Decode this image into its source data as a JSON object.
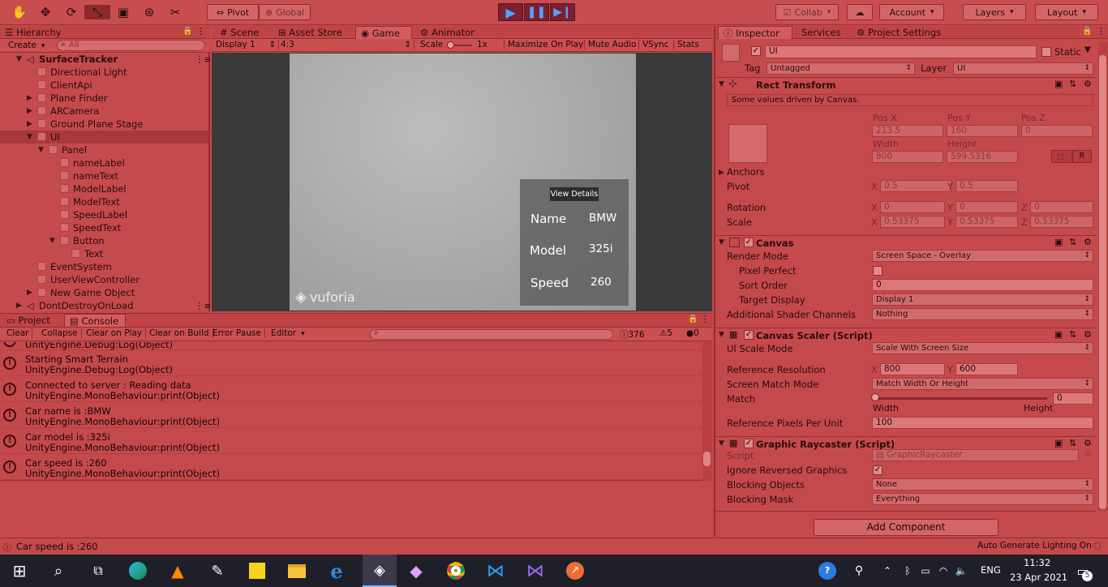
{
  "toolbar": {
    "pivot": "Pivot",
    "global": "Global",
    "collab": "Collab",
    "account": "Account",
    "layers": "Layers",
    "layout": "Layout"
  },
  "hierarchy": {
    "tab": "Hierarchy",
    "create": "Create",
    "search_placeholder": "All",
    "items": [
      {
        "label": "SurfaceTracker"
      },
      {
        "label": "Directional Light"
      },
      {
        "label": "ClientApi"
      },
      {
        "label": "Plane Finder"
      },
      {
        "label": "ARCamera"
      },
      {
        "label": "Ground Plane Stage"
      },
      {
        "label": "UI"
      },
      {
        "label": "Panel"
      },
      {
        "label": "nameLabel"
      },
      {
        "label": "nameText"
      },
      {
        "label": "ModelLabel"
      },
      {
        "label": "ModelText"
      },
      {
        "label": "SpeedLabel"
      },
      {
        "label": "SpeedText"
      },
      {
        "label": "Button"
      },
      {
        "label": "Text"
      },
      {
        "label": "EventSystem"
      },
      {
        "label": "UserViewController"
      },
      {
        "label": "New Game Object"
      },
      {
        "label": "DontDestroyOnLoad"
      }
    ]
  },
  "center_tabs": {
    "scene": "Scene",
    "asset_store": "Asset Store",
    "game": "Game",
    "animator": "Animator"
  },
  "game_bar": {
    "display": "Display 1",
    "aspect": "4:3",
    "scale_label": "Scale",
    "scale_value": "1x",
    "maximize": "Maximize On Play",
    "mute": "Mute Audio",
    "vsync": "VSync",
    "stats": "Stats"
  },
  "game_view": {
    "view_details": "View Details",
    "name_label": "Name",
    "name_value": "BMW",
    "model_label": "Model",
    "model_value": "325i",
    "speed_label": "Speed",
    "speed_value": "260",
    "watermark": "vuforia"
  },
  "bottom_tabs": {
    "project": "Project",
    "console": "Console"
  },
  "console_bar": {
    "clear": "Clear",
    "collapse": "Collapse",
    "clear_on_play": "Clear on Play",
    "clear_on_build": "Clear on Build",
    "error_pause": "Error Pause",
    "editor": "Editor",
    "errors": "376",
    "warnings": "5",
    "logs": "0"
  },
  "console_logs": [
    {
      "line1": "",
      "line2": "UnityEngine.Debug:Log(Object)"
    },
    {
      "line1": "Starting Smart Terrain",
      "line2": "UnityEngine.Debug:Log(Object)"
    },
    {
      "line1": "Connected to server : Reading data",
      "line2": "UnityEngine.MonoBehaviour:print(Object)"
    },
    {
      "line1": "Car name is :BMW",
      "line2": "UnityEngine.MonoBehaviour:print(Object)"
    },
    {
      "line1": "Car model is :325i",
      "line2": "UnityEngine.MonoBehaviour:print(Object)"
    },
    {
      "line1": "Car speed is :260",
      "line2": "UnityEngine.MonoBehaviour:print(Object)"
    }
  ],
  "status_bar": {
    "message": "Car speed is :260",
    "right": "Auto Generate Lighting On"
  },
  "inspector_tabs": {
    "inspector": "Inspector",
    "services": "Services",
    "project_settings": "Project Settings"
  },
  "inspector": {
    "name": "UI",
    "static": "Static",
    "tag_label": "Tag",
    "tag": "Untagged",
    "layer_label": "Layer",
    "layer": "UI",
    "rect": {
      "title": "Rect Transform",
      "note": "Some values driven by Canvas.",
      "posx_l": "Pos X",
      "posy_l": "Pos Y",
      "posz_l": "Pos Z",
      "posx": "213.5",
      "posy": "160",
      "posz": "0",
      "width_l": "Width",
      "height_l": "Height",
      "width": "800",
      "height": "599.5316",
      "r": "R",
      "anchors": "Anchors",
      "pivot": "Pivot",
      "pivot_x": "0.5",
      "pivot_y": "0.5",
      "rotation": "Rotation",
      "rot_x": "0",
      "rot_y": "0",
      "rot_z": "0",
      "scale": "Scale",
      "scale_x": "0.53375",
      "scale_y": "0.53375",
      "scale_z": "0.53375",
      "x": "X",
      "y": "Y",
      "z": "Z"
    },
    "canvas": {
      "title": "Canvas",
      "render_mode_l": "Render Mode",
      "render_mode": "Screen Space - Overlay",
      "pixel_perfect": "Pixel Perfect",
      "sort_order_l": "Sort Order",
      "sort_order": "0",
      "target_display_l": "Target Display",
      "target_display": "Display 1",
      "shader_l": "Additional Shader Channels",
      "shader": "Nothing"
    },
    "scaler": {
      "title": "Canvas Scaler (Script)",
      "mode_l": "UI Scale Mode",
      "mode": "Scale With Screen Size",
      "ref_res_l": "Reference Resolution",
      "ref_x": "800",
      "ref_y": "600",
      "match_mode_l": "Screen Match Mode",
      "match_mode": "Match Width Or Height",
      "match_l": "Match",
      "match": "0",
      "match_fraction": 0,
      "width": "Width",
      "height": "Height",
      "ppu_l": "Reference Pixels Per Unit",
      "ppu": "100"
    },
    "raycaster": {
      "title": "Graphic Raycaster (Script)",
      "script_l": "Script",
      "script": "GraphicRaycaster",
      "ignore_l": "Ignore Reversed Graphics",
      "blocking_objects_l": "Blocking Objects",
      "blocking_objects": "None",
      "blocking_mask_l": "Blocking Mask",
      "blocking_mask": "Everything"
    },
    "add_component": "Add Component"
  },
  "taskbar": {
    "time": "11:32",
    "date": "23 Apr 2021",
    "lang": "ENG",
    "notif_count": "5"
  }
}
